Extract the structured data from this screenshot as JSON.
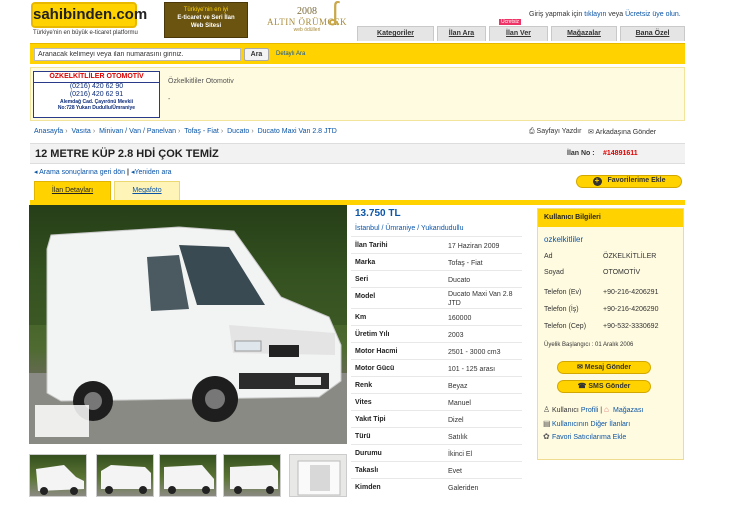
{
  "header": {
    "logo": "sahibinden.com",
    "tagline": "Türkiye'nin en büyük e-ticaret platformu",
    "promo_line1": "Türkiye'nin en iyi",
    "promo_line2": "E-ticaret ve Seri İlan",
    "promo_line3": "Web Sitesi",
    "award_year": "2008",
    "award_name": "ALTIN ÖRÜMCEK",
    "award_sub": "web ödülleri",
    "login_prefix": "Giriş yapmak için ",
    "login_link": "tıklayın",
    "login_mid": " veya ",
    "signup_link": "Ücretsiz üye olun."
  },
  "nav": {
    "tabs": [
      "Kategoriler",
      "İlan Ara",
      "İlan Ver",
      "Mağazalar",
      "Bana Özel"
    ],
    "badge": "Ücretsiz"
  },
  "search": {
    "value": "Aranacak kelimeyi veya ilan numarasını giriniz.",
    "button": "Ara",
    "detail_link": "Detaylı Ara"
  },
  "store": {
    "logo_title": "ÖZKELKİTLİLER OTOMOTİV",
    "logo_phone1": "(0216) 420 62 90",
    "logo_phone2": "(0216) 420 62 91",
    "logo_addr1": "Alemdağ Cad. Çayırönü Mevkii",
    "logo_addr2": "No:728 Yukarı Dudullu/Ümraniye",
    "name": "Özkelkitliler Otomotiv",
    "line": "-"
  },
  "breadcrumb": [
    "Anasayfa",
    "Vasıta",
    "Minivan / Van / Panelvan",
    "Tofaş - Fiat",
    "Ducato",
    "Ducato Maxi Van 2.8 JTD"
  ],
  "actions": {
    "print": "Sayfayı Yazdır",
    "send": "Arkadaşına Gönder"
  },
  "listing": {
    "title": "12 METRE KÜP 2.8 HDİ ÇOK TEMİZ",
    "no_label": "İlan No :",
    "no": "#14891611",
    "back_link": "Arama sonuçlarına geri dön",
    "new_search": "Yeniden ara",
    "favorites": "Favorilerime Ekle",
    "tab_details": "İlan Detayları",
    "tab_megafoto": "Megafoto",
    "price": "13.750 TL",
    "location": [
      "İstanbul",
      "Ümraniye",
      "Yukarıdudullu"
    ],
    "watermark": "www.sahibinden.com",
    "specs": [
      {
        "k": "İlan Tarihi",
        "v": "17 Haziran 2009"
      },
      {
        "k": "Marka",
        "v": "Tofaş - Fiat"
      },
      {
        "k": "Seri",
        "v": "Ducato"
      },
      {
        "k": "Model",
        "v": "Ducato Maxi Van 2.8 JTD"
      },
      {
        "k": "Km",
        "v": "160000"
      },
      {
        "k": "Üretim Yılı",
        "v": "2003"
      },
      {
        "k": "Motor Hacmi",
        "v": "2501 - 3000 cm3"
      },
      {
        "k": "Motor Gücü",
        "v": "101 - 125 arası"
      },
      {
        "k": "Renk",
        "v": "Beyaz"
      },
      {
        "k": "Vites",
        "v": "Manuel"
      },
      {
        "k": "Yakıt Tipi",
        "v": "Dizel"
      },
      {
        "k": "Türü",
        "v": "Satılık"
      },
      {
        "k": "Durumu",
        "v": "İkinci El"
      },
      {
        "k": "Takaslı",
        "v": "Evet"
      },
      {
        "k": "Kimden",
        "v": "Galeriden"
      }
    ]
  },
  "user": {
    "box_title": "Kullanıcı Bilgileri",
    "username": "ozkelkitliler",
    "rows": [
      {
        "k": "Ad",
        "v": "ÖZKELKİTLİLER"
      },
      {
        "k": "Soyad",
        "v": "OTOMOTİV"
      },
      {
        "k": "Telefon (Ev)",
        "v": "+90-216-4206291"
      },
      {
        "k": "Telefon (İş)",
        "v": "+90-216-4206290"
      },
      {
        "k": "Telefon (Cep)",
        "v": "+90-532-3330692"
      }
    ],
    "since": "Üyelik Başlangıcı : 01 Aralık 2006",
    "message_btn": "Mesaj Gönder",
    "sms_btn": "SMS Gönder",
    "link_user": "Kullanıcı",
    "link_profile": "Profili",
    "link_store": "Mağazası",
    "link_other": "Kullanıcının Diğer İlanları",
    "link_fav": "Favori Satıcılarıma Ekle"
  },
  "colors": {
    "accent": "#ffd200",
    "link": "#0b55a8",
    "ilan_no": "#dd0000"
  }
}
